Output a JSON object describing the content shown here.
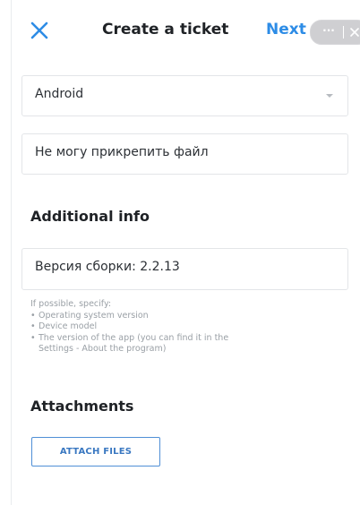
{
  "header": {
    "title": "Create a ticket",
    "next_label": "Next",
    "close_icon": "close-icon",
    "more_icon": "more-icon",
    "capsule_close_icon": "close-icon",
    "more_glyph": "···",
    "accent_color": "#2d8ce6"
  },
  "form": {
    "platform": {
      "value": "Android",
      "icon": "chevron-down-icon"
    },
    "subject": {
      "value": "Не могу прикрепить файл"
    },
    "additional": {
      "heading": "Additional info",
      "value": "Версия сборки: 2.2.13",
      "hint": {
        "intro": "If possible, specify:",
        "items": [
          "Operating system version",
          "Device model",
          "The version of the app (you can find it in the",
          "Settings - About the program)"
        ],
        "bullet": "•"
      }
    },
    "attachments": {
      "heading": "Attachments",
      "button_label": "ATTACH FILES"
    }
  }
}
